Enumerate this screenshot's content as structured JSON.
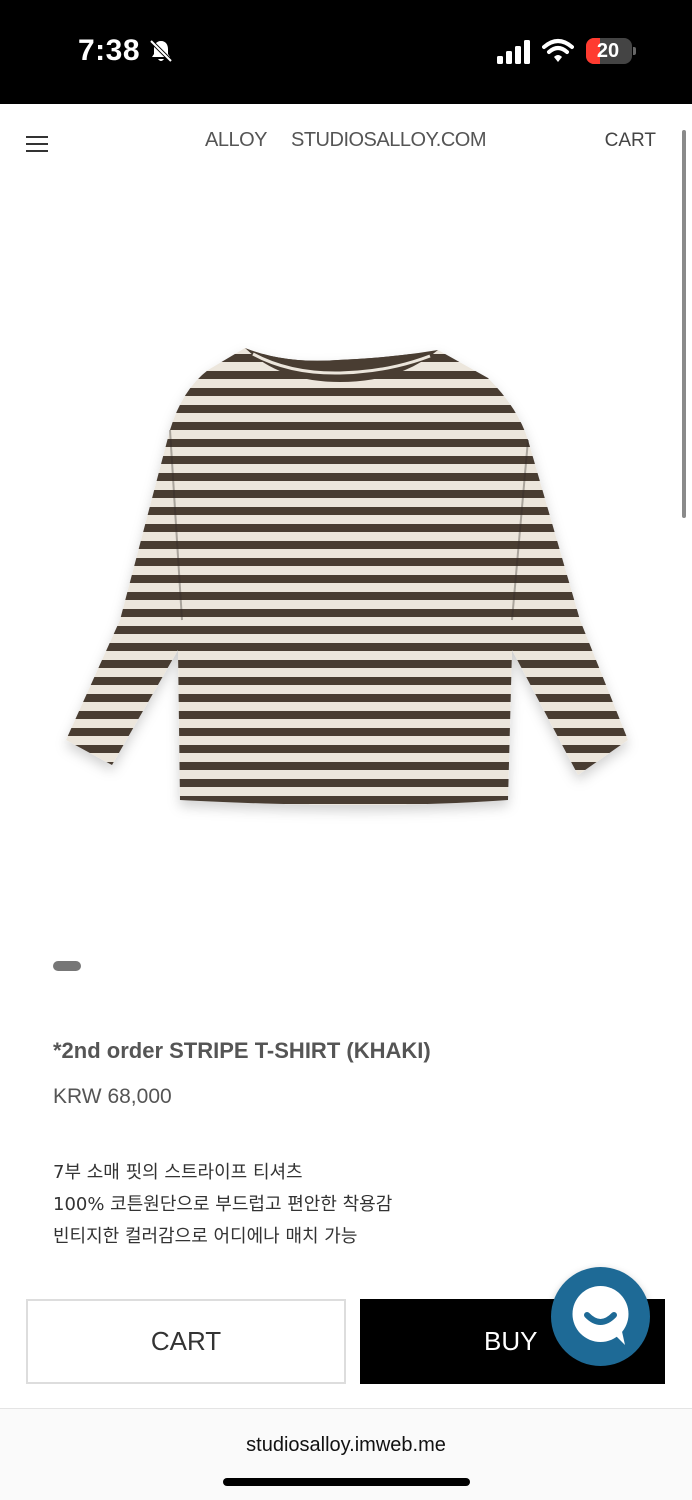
{
  "status_bar": {
    "time": "7:38",
    "battery": "20",
    "icons": [
      "bell-slash-icon",
      "signal-icon",
      "wifi-icon",
      "battery-icon"
    ]
  },
  "header": {
    "brand": "ALLOY",
    "site": "STUDIOSALLOY.COM",
    "cart_label": "CART",
    "menu_icon": "hamburger-menu-icon"
  },
  "product": {
    "image_alt": "striped long-sleeve t-shirt",
    "stripe_colors": [
      "#4a3e33",
      "#ece6dc"
    ],
    "title": "*2nd order STRIPE T-SHIRT (KHAKI)",
    "price": "KRW 68,000",
    "description": [
      "7부 소매 핏의 스트라이프 티셔츠",
      "100% 코튼원단으로 부드럽고 편안한 착용감",
      "빈티지한 컬러감으로 어디에나 매치 가능"
    ]
  },
  "actions": {
    "cart_label": "CART",
    "buy_label": "BUY",
    "chat_icon": "chat-bubble-icon",
    "chat_color": "#1e6a96"
  },
  "browser": {
    "url": "studiosalloy.imweb.me"
  }
}
